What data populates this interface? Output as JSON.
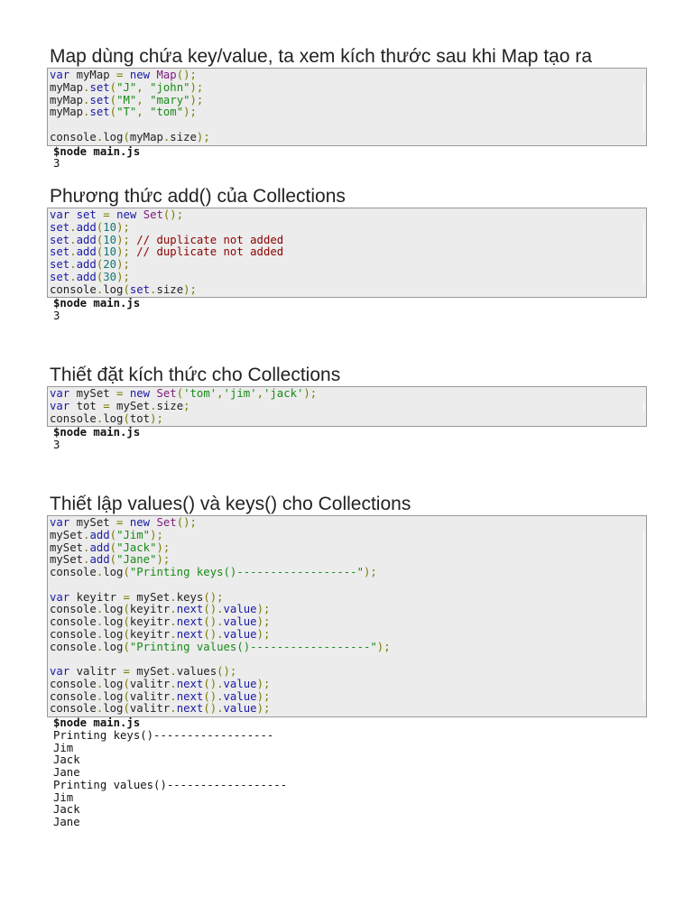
{
  "sections": [
    {
      "heading": "Map dùng chứa key/value, ta xem kích thước sau khi Map tạo ra",
      "code": [
        [
          [
            "var",
            "k"
          ],
          [
            " myMap ",
            ""
          ],
          [
            "=",
            "p"
          ],
          [
            " ",
            ""
          ],
          [
            "new",
            "k"
          ],
          [
            " ",
            ""
          ],
          [
            "Map",
            "t"
          ],
          [
            "();",
            "p"
          ]
        ],
        [
          [
            "myMap",
            ""
          ],
          [
            ".",
            "p"
          ],
          [
            "set",
            "m"
          ],
          [
            "(",
            "p"
          ],
          [
            "\"J\"",
            "s"
          ],
          [
            ", ",
            "p"
          ],
          [
            "\"john\"",
            "s"
          ],
          [
            ");",
            "p"
          ]
        ],
        [
          [
            "myMap",
            ""
          ],
          [
            ".",
            "p"
          ],
          [
            "set",
            "m"
          ],
          [
            "(",
            "p"
          ],
          [
            "\"M\"",
            "s"
          ],
          [
            ", ",
            "p"
          ],
          [
            "\"mary\"",
            "s"
          ],
          [
            ");",
            "p"
          ]
        ],
        [
          [
            "myMap",
            ""
          ],
          [
            ".",
            "p"
          ],
          [
            "set",
            "m"
          ],
          [
            "(",
            "p"
          ],
          [
            "\"T\"",
            "s"
          ],
          [
            ", ",
            "p"
          ],
          [
            "\"tom\"",
            "s"
          ],
          [
            ");",
            "p"
          ]
        ],
        [],
        [
          [
            "console",
            ""
          ],
          [
            ".",
            "p"
          ],
          [
            "log",
            ""
          ],
          [
            "(",
            "p"
          ],
          [
            "myMap",
            ""
          ],
          [
            ".",
            "p"
          ],
          [
            "size",
            ""
          ],
          [
            ");",
            "p"
          ]
        ]
      ],
      "output": {
        "command": "$node main.js",
        "lines": [
          "3"
        ]
      }
    },
    {
      "heading": "Phương thức add() của Collections",
      "code": [
        [
          [
            "var",
            "k"
          ],
          [
            " ",
            ""
          ],
          [
            "set",
            "m"
          ],
          [
            " ",
            ""
          ],
          [
            "=",
            "p"
          ],
          [
            " ",
            ""
          ],
          [
            "new",
            "k"
          ],
          [
            " ",
            ""
          ],
          [
            "Set",
            "t"
          ],
          [
            "();",
            "p"
          ]
        ],
        [
          [
            "set",
            "m"
          ],
          [
            ".",
            "p"
          ],
          [
            "add",
            "m"
          ],
          [
            "(",
            "p"
          ],
          [
            "10",
            "n"
          ],
          [
            ");",
            "p"
          ]
        ],
        [
          [
            "set",
            "m"
          ],
          [
            ".",
            "p"
          ],
          [
            "add",
            "m"
          ],
          [
            "(",
            "p"
          ],
          [
            "10",
            "n"
          ],
          [
            ");",
            "p"
          ],
          [
            " // duplicate not added",
            "c"
          ]
        ],
        [
          [
            "set",
            "m"
          ],
          [
            ".",
            "p"
          ],
          [
            "add",
            "m"
          ],
          [
            "(",
            "p"
          ],
          [
            "10",
            "n"
          ],
          [
            ");",
            "p"
          ],
          [
            " // duplicate not added",
            "c"
          ]
        ],
        [
          [
            "set",
            "m"
          ],
          [
            ".",
            "p"
          ],
          [
            "add",
            "m"
          ],
          [
            "(",
            "p"
          ],
          [
            "20",
            "n"
          ],
          [
            ");",
            "p"
          ]
        ],
        [
          [
            "set",
            "m"
          ],
          [
            ".",
            "p"
          ],
          [
            "add",
            "m"
          ],
          [
            "(",
            "p"
          ],
          [
            "30",
            "n"
          ],
          [
            ");",
            "p"
          ]
        ],
        [
          [
            "console",
            ""
          ],
          [
            ".",
            "p"
          ],
          [
            "log",
            ""
          ],
          [
            "(",
            "p"
          ],
          [
            "set",
            "m"
          ],
          [
            ".",
            "p"
          ],
          [
            "size",
            ""
          ],
          [
            ");",
            "p"
          ]
        ]
      ],
      "output": {
        "command": "$node main.js",
        "lines": [
          "3"
        ]
      }
    },
    {
      "heading": "Thiết đặt kích thức cho Collections",
      "code": [
        [
          [
            "var",
            "k"
          ],
          [
            " mySet ",
            ""
          ],
          [
            "=",
            "p"
          ],
          [
            " ",
            ""
          ],
          [
            "new",
            "k"
          ],
          [
            " ",
            ""
          ],
          [
            "Set",
            "t"
          ],
          [
            "(",
            "p"
          ],
          [
            "'tom'",
            "s"
          ],
          [
            ",",
            "p"
          ],
          [
            "'jim'",
            "s"
          ],
          [
            ",",
            "p"
          ],
          [
            "'jack'",
            "s"
          ],
          [
            ");",
            "p"
          ]
        ],
        [
          [
            "var",
            "k"
          ],
          [
            " tot ",
            ""
          ],
          [
            "=",
            "p"
          ],
          [
            " mySet",
            ""
          ],
          [
            ".",
            "p"
          ],
          [
            "size",
            ""
          ],
          [
            ";",
            "p"
          ]
        ],
        [
          [
            "console",
            ""
          ],
          [
            ".",
            "p"
          ],
          [
            "log",
            ""
          ],
          [
            "(",
            "p"
          ],
          [
            "tot",
            ""
          ],
          [
            ");",
            "p"
          ]
        ]
      ],
      "output": {
        "command": "$node main.js",
        "lines": [
          "3"
        ]
      }
    },
    {
      "heading": "Thiết lập values() và keys() cho Collections",
      "code": [
        [
          [
            "var",
            "k"
          ],
          [
            " mySet ",
            ""
          ],
          [
            "=",
            "p"
          ],
          [
            " ",
            ""
          ],
          [
            "new",
            "k"
          ],
          [
            " ",
            ""
          ],
          [
            "Set",
            "t"
          ],
          [
            "();",
            "p"
          ]
        ],
        [
          [
            "mySet",
            ""
          ],
          [
            ".",
            "p"
          ],
          [
            "add",
            "m"
          ],
          [
            "(",
            "p"
          ],
          [
            "\"Jim\"",
            "s"
          ],
          [
            ");",
            "p"
          ]
        ],
        [
          [
            "mySet",
            ""
          ],
          [
            ".",
            "p"
          ],
          [
            "add",
            "m"
          ],
          [
            "(",
            "p"
          ],
          [
            "\"Jack\"",
            "s"
          ],
          [
            ");",
            "p"
          ]
        ],
        [
          [
            "mySet",
            ""
          ],
          [
            ".",
            "p"
          ],
          [
            "add",
            "m"
          ],
          [
            "(",
            "p"
          ],
          [
            "\"Jane\"",
            "s"
          ],
          [
            ");",
            "p"
          ]
        ],
        [
          [
            "console",
            ""
          ],
          [
            ".",
            "p"
          ],
          [
            "log",
            ""
          ],
          [
            "(",
            "p"
          ],
          [
            "\"Printing keys()------------------\"",
            "s"
          ],
          [
            ");",
            "p"
          ]
        ],
        [],
        [
          [
            "var",
            "k"
          ],
          [
            " keyitr ",
            ""
          ],
          [
            "=",
            "p"
          ],
          [
            " mySet",
            ""
          ],
          [
            ".",
            "p"
          ],
          [
            "keys",
            ""
          ],
          [
            "();",
            "p"
          ]
        ],
        [
          [
            "console",
            ""
          ],
          [
            ".",
            "p"
          ],
          [
            "log",
            ""
          ],
          [
            "(",
            "p"
          ],
          [
            "keyitr",
            ""
          ],
          [
            ".",
            "p"
          ],
          [
            "next",
            "m"
          ],
          [
            "().",
            "p"
          ],
          [
            "value",
            "m"
          ],
          [
            ");",
            "p"
          ]
        ],
        [
          [
            "console",
            ""
          ],
          [
            ".",
            "p"
          ],
          [
            "log",
            ""
          ],
          [
            "(",
            "p"
          ],
          [
            "keyitr",
            ""
          ],
          [
            ".",
            "p"
          ],
          [
            "next",
            "m"
          ],
          [
            "().",
            "p"
          ],
          [
            "value",
            "m"
          ],
          [
            ");",
            "p"
          ]
        ],
        [
          [
            "console",
            ""
          ],
          [
            ".",
            "p"
          ],
          [
            "log",
            ""
          ],
          [
            "(",
            "p"
          ],
          [
            "keyitr",
            ""
          ],
          [
            ".",
            "p"
          ],
          [
            "next",
            "m"
          ],
          [
            "().",
            "p"
          ],
          [
            "value",
            "m"
          ],
          [
            ");",
            "p"
          ]
        ],
        [
          [
            "console",
            ""
          ],
          [
            ".",
            "p"
          ],
          [
            "log",
            ""
          ],
          [
            "(",
            "p"
          ],
          [
            "\"Printing values()------------------\"",
            "s"
          ],
          [
            ");",
            "p"
          ]
        ],
        [],
        [
          [
            "var",
            "k"
          ],
          [
            " valitr ",
            ""
          ],
          [
            "=",
            "p"
          ],
          [
            " mySet",
            ""
          ],
          [
            ".",
            "p"
          ],
          [
            "values",
            ""
          ],
          [
            "();",
            "p"
          ]
        ],
        [
          [
            "console",
            ""
          ],
          [
            ".",
            "p"
          ],
          [
            "log",
            ""
          ],
          [
            "(",
            "p"
          ],
          [
            "valitr",
            ""
          ],
          [
            ".",
            "p"
          ],
          [
            "next",
            "m"
          ],
          [
            "().",
            "p"
          ],
          [
            "value",
            "m"
          ],
          [
            ");",
            "p"
          ]
        ],
        [
          [
            "console",
            ""
          ],
          [
            ".",
            "p"
          ],
          [
            "log",
            ""
          ],
          [
            "(",
            "p"
          ],
          [
            "valitr",
            ""
          ],
          [
            ".",
            "p"
          ],
          [
            "next",
            "m"
          ],
          [
            "().",
            "p"
          ],
          [
            "value",
            "m"
          ],
          [
            ");",
            "p"
          ]
        ],
        [
          [
            "console",
            ""
          ],
          [
            ".",
            "p"
          ],
          [
            "log",
            ""
          ],
          [
            "(",
            "p"
          ],
          [
            "valitr",
            ""
          ],
          [
            ".",
            "p"
          ],
          [
            "next",
            "m"
          ],
          [
            "().",
            "p"
          ],
          [
            "value",
            "m"
          ],
          [
            ");",
            "p"
          ]
        ]
      ],
      "output": {
        "command": "$node main.js",
        "lines": [
          "Printing keys()------------------",
          "Jim",
          "Jack",
          "Jane",
          "Printing values()------------------",
          "Jim",
          "Jack",
          "Jane"
        ]
      }
    }
  ]
}
